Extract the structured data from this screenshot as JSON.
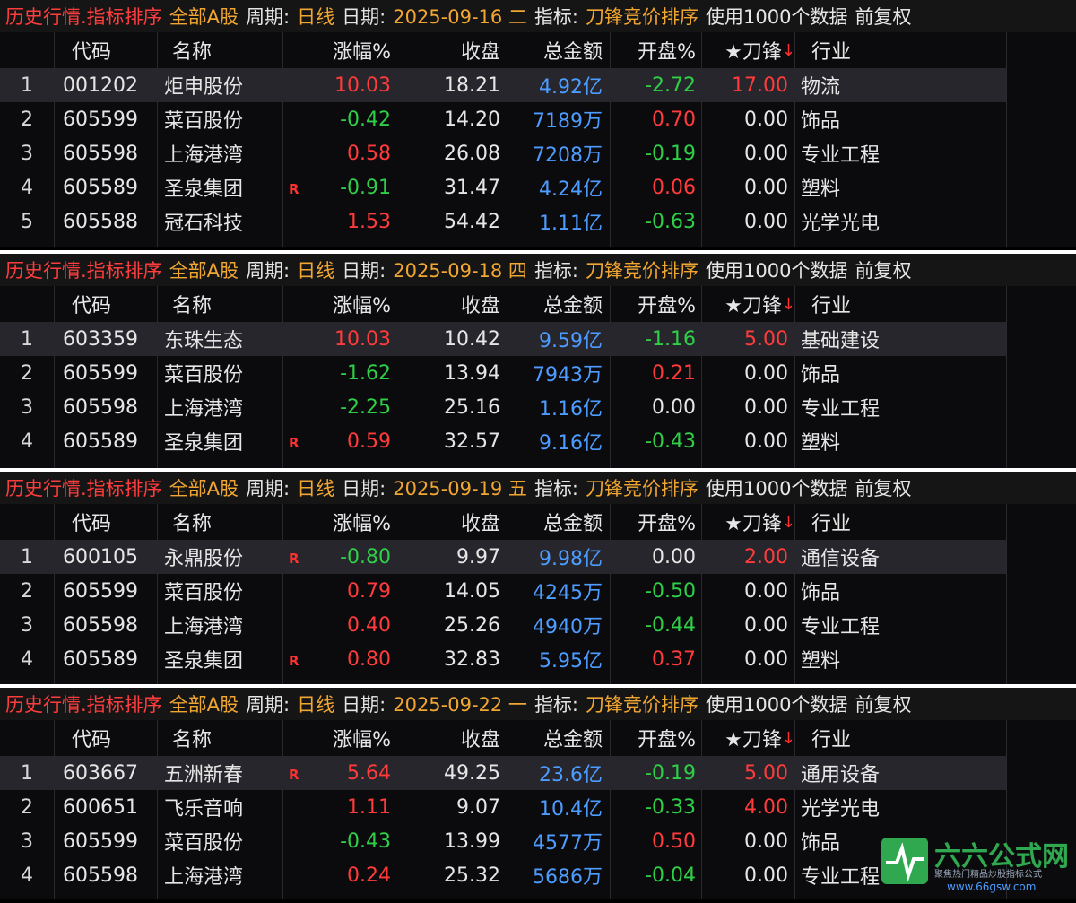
{
  "title_parts": {
    "mode": "历史行情.指标排序",
    "market": "全部A股",
    "period_label": "周期:",
    "period_value": "日线",
    "date_label": "日期:",
    "indicator_label": "指标:",
    "indicator_value": "刀锋竞价排序",
    "data_info": "使用1000个数据",
    "adjust": "前复权"
  },
  "columns": {
    "code": "代码",
    "name": "名称",
    "change": "涨幅%",
    "close": "收盘",
    "amount": "总金额",
    "open": "开盘%",
    "knife": "★刀锋",
    "industry": "行业"
  },
  "sort_arrow": "↓",
  "r_mark": "R",
  "panels": [
    {
      "date": "2025-09-16 二",
      "rows": [
        {
          "n": "1",
          "code": "001202",
          "name": "炬申股份",
          "r": false,
          "chg": "10.03",
          "chg_dir": "up",
          "close": "18.21",
          "amt": "4.92亿",
          "open": "-2.72",
          "open_dir": "down",
          "knife": "17.00",
          "knife_dir": "up",
          "ind": "物流"
        },
        {
          "n": "2",
          "code": "605599",
          "name": "菜百股份",
          "r": false,
          "chg": "-0.42",
          "chg_dir": "down",
          "close": "14.20",
          "amt": "7189万",
          "open": "0.70",
          "open_dir": "up",
          "knife": "0.00",
          "knife_dir": "flat",
          "ind": "饰品"
        },
        {
          "n": "3",
          "code": "605598",
          "name": "上海港湾",
          "r": false,
          "chg": "0.58",
          "chg_dir": "up",
          "close": "26.08",
          "amt": "7208万",
          "open": "-0.19",
          "open_dir": "down",
          "knife": "0.00",
          "knife_dir": "flat",
          "ind": "专业工程"
        },
        {
          "n": "4",
          "code": "605589",
          "name": "圣泉集团",
          "r": true,
          "chg": "-0.91",
          "chg_dir": "down",
          "close": "31.47",
          "amt": "4.24亿",
          "open": "0.06",
          "open_dir": "up",
          "knife": "0.00",
          "knife_dir": "flat",
          "ind": "塑料"
        },
        {
          "n": "5",
          "code": "605588",
          "name": "冠石科技",
          "r": false,
          "chg": "1.53",
          "chg_dir": "up",
          "close": "54.42",
          "amt": "1.11亿",
          "open": "-0.63",
          "open_dir": "down",
          "knife": "0.00",
          "knife_dir": "flat",
          "ind": "光学光电"
        }
      ]
    },
    {
      "date": "2025-09-18 四",
      "rows": [
        {
          "n": "1",
          "code": "603359",
          "name": "东珠生态",
          "r": false,
          "chg": "10.03",
          "chg_dir": "up",
          "close": "10.42",
          "amt": "9.59亿",
          "open": "-1.16",
          "open_dir": "down",
          "knife": "5.00",
          "knife_dir": "up",
          "ind": "基础建设"
        },
        {
          "n": "2",
          "code": "605599",
          "name": "菜百股份",
          "r": false,
          "chg": "-1.62",
          "chg_dir": "down",
          "close": "13.94",
          "amt": "7943万",
          "open": "0.21",
          "open_dir": "up",
          "knife": "0.00",
          "knife_dir": "flat",
          "ind": "饰品"
        },
        {
          "n": "3",
          "code": "605598",
          "name": "上海港湾",
          "r": false,
          "chg": "-2.25",
          "chg_dir": "down",
          "close": "25.16",
          "amt": "1.16亿",
          "open": "0.00",
          "open_dir": "flat",
          "knife": "0.00",
          "knife_dir": "flat",
          "ind": "专业工程"
        },
        {
          "n": "4",
          "code": "605589",
          "name": "圣泉集团",
          "r": true,
          "chg": "0.59",
          "chg_dir": "up",
          "close": "32.57",
          "amt": "9.16亿",
          "open": "-0.43",
          "open_dir": "down",
          "knife": "0.00",
          "knife_dir": "flat",
          "ind": "塑料"
        }
      ]
    },
    {
      "date": "2025-09-19 五",
      "rows": [
        {
          "n": "1",
          "code": "600105",
          "name": "永鼎股份",
          "r": true,
          "chg": "-0.80",
          "chg_dir": "down",
          "close": "9.97",
          "amt": "9.98亿",
          "open": "0.00",
          "open_dir": "flat",
          "knife": "2.00",
          "knife_dir": "up",
          "ind": "通信设备"
        },
        {
          "n": "2",
          "code": "605599",
          "name": "菜百股份",
          "r": false,
          "chg": "0.79",
          "chg_dir": "up",
          "close": "14.05",
          "amt": "4245万",
          "open": "-0.50",
          "open_dir": "down",
          "knife": "0.00",
          "knife_dir": "flat",
          "ind": "饰品"
        },
        {
          "n": "3",
          "code": "605598",
          "name": "上海港湾",
          "r": false,
          "chg": "0.40",
          "chg_dir": "up",
          "close": "25.26",
          "amt": "4940万",
          "open": "-0.44",
          "open_dir": "down",
          "knife": "0.00",
          "knife_dir": "flat",
          "ind": "专业工程"
        },
        {
          "n": "4",
          "code": "605589",
          "name": "圣泉集团",
          "r": true,
          "chg": "0.80",
          "chg_dir": "up",
          "close": "32.83",
          "amt": "5.95亿",
          "open": "0.37",
          "open_dir": "up",
          "knife": "0.00",
          "knife_dir": "flat",
          "ind": "塑料"
        }
      ]
    },
    {
      "date": "2025-09-22 一",
      "rows": [
        {
          "n": "1",
          "code": "603667",
          "name": "五洲新春",
          "r": true,
          "chg": "5.64",
          "chg_dir": "up",
          "close": "49.25",
          "amt": "23.6亿",
          "open": "-0.19",
          "open_dir": "down",
          "knife": "5.00",
          "knife_dir": "up",
          "ind": "通用设备"
        },
        {
          "n": "2",
          "code": "600651",
          "name": "飞乐音响",
          "r": false,
          "chg": "1.11",
          "chg_dir": "up",
          "close": "9.07",
          "amt": "10.4亿",
          "open": "-0.33",
          "open_dir": "down",
          "knife": "4.00",
          "knife_dir": "up",
          "ind": "光学光电"
        },
        {
          "n": "3",
          "code": "605599",
          "name": "菜百股份",
          "r": false,
          "chg": "-0.43",
          "chg_dir": "down",
          "close": "13.99",
          "amt": "4577万",
          "open": "0.50",
          "open_dir": "up",
          "knife": "0.00",
          "knife_dir": "flat",
          "ind": "饰品"
        },
        {
          "n": "4",
          "code": "605598",
          "name": "上海港湾",
          "r": false,
          "chg": "0.24",
          "chg_dir": "up",
          "close": "25.32",
          "amt": "5686万",
          "open": "-0.04",
          "open_dir": "down",
          "knife": "0.00",
          "knife_dir": "flat",
          "ind": "专业工程"
        }
      ]
    }
  ],
  "watermark": {
    "site_name": "六六公式网",
    "tagline": "聚焦热门精品炒股指标公式",
    "url": "www.66gsw.com"
  }
}
